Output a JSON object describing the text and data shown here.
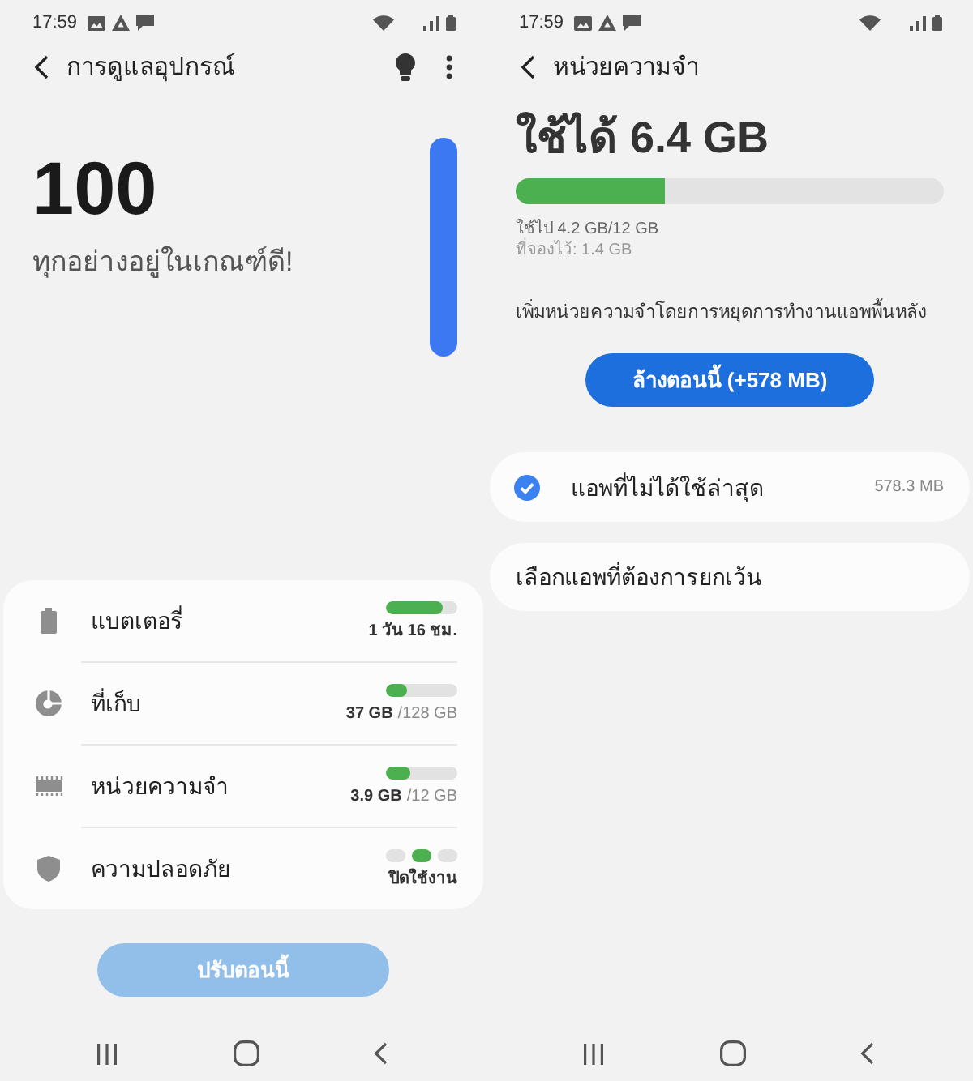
{
  "screens": [
    {
      "kind": "device_care",
      "status_bar": {
        "time": "17:59"
      },
      "header": {
        "title": "การดูแลอุปกรณ์"
      },
      "score": {
        "value": "100",
        "message": "ทุกอย่างอยู่ในเกณฑ์ดี!"
      },
      "items": [
        {
          "kind": "battery",
          "label": "แบตเตอรี่",
          "level": 0.8,
          "value": "1 วัน 16 ชม."
        },
        {
          "kind": "storage",
          "label": "ที่เก็บ",
          "level": 0.29,
          "value": "37 GB",
          "total": "/128 GB"
        },
        {
          "kind": "memory",
          "label": "หน่วยความจำ",
          "level": 0.33,
          "value": "3.9 GB",
          "total": "/12 GB"
        },
        {
          "kind": "security",
          "label": "ความปลอดภัย",
          "dots": [
            {
              "on": false
            },
            {
              "on": true
            },
            {
              "on": false
            }
          ],
          "value": "ปิดใช้งาน"
        }
      ],
      "button": {
        "label": "ปรับตอนนี้",
        "disabled": true
      }
    },
    {
      "kind": "memory",
      "status_bar": {
        "time": "17:59"
      },
      "header": {
        "title": "หน่วยความจำ"
      },
      "available": "ใช้ได้ 6.4 GB",
      "usage": {
        "level": 0.35,
        "used": "ใช้ไป 4.2 GB/12 GB",
        "reserved": "ที่จองไว้: 1.4 GB"
      },
      "description": "เพิ่มหน่วยความจำโดยการหยุดการทำงานแอพพื้นหลัง",
      "button": {
        "label": "ล้างตอนนี้ (+578 MB)",
        "disabled": false
      },
      "options": [
        {
          "kind": "checkbox",
          "label": "แอพที่ไม่ได้ใช้ล่าสุด",
          "value": "578.3 MB",
          "checked": true
        },
        {
          "kind": "link",
          "label": "เลือกแอพที่ต้องการยกเว้น"
        }
      ]
    }
  ]
}
